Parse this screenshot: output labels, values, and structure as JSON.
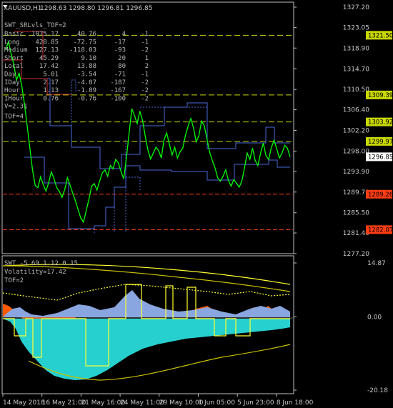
{
  "header": {
    "symbol": "XAUUSD,H1",
    "ohlc": "1298.63 1298.80 1296.81 1296.85"
  },
  "info_panel": {
    "title": "SWT_SRLvls_TOF=2",
    "rows": [
      {
        "label": "Basic",
        "a": "1075.17",
        "b": "40.76",
        "c": "4",
        "d": "-1"
      },
      {
        "label": "Long",
        "a": "428.85",
        "b": "-72.75",
        "c": "-17",
        "d": "-1"
      },
      {
        "label": "Medium",
        "a": "127.13",
        "b": "-118.03",
        "c": "-93",
        "d": "-2"
      },
      {
        "label": "Short",
        "a": "45.29",
        "b": "9.10",
        "c": "20",
        "d": "1"
      },
      {
        "label": "Local",
        "a": "17.42",
        "b": "13.88",
        "c": "80",
        "d": "2"
      },
      {
        "label": "Day",
        "a": "5.01",
        "b": "-3.54",
        "c": "-71",
        "d": "-1"
      },
      {
        "label": "IDay",
        "a": "2.17",
        "b": "-4.07",
        "c": "-187",
        "d": "-2"
      },
      {
        "label": "Hour",
        "a": "1.13",
        "b": "-1.89",
        "c": "-167",
        "d": "-2"
      },
      {
        "label": "IHour",
        "a": "0.76",
        "b": "-0.76",
        "c": "-100",
        "d": "-2"
      }
    ],
    "v_line": "V=2.31",
    "tof_line": "TOF=4"
  },
  "indicator": {
    "line1": "SWT -5.69 1.12 0.15",
    "line2": "Volatility=17.42",
    "line3": "TOF=2"
  },
  "colors": {
    "price": "#00ff00",
    "channel": "#4a6ad8",
    "level_green": "#c8d800",
    "level_red": "#ff3c14",
    "cyan": "#26d0ce",
    "orange": "#ff5a00",
    "yellow": "#ffff30",
    "blue_fill": "#8aa6e0",
    "gold": "#c8c000"
  },
  "chart_data": [
    {
      "type": "line",
      "title": "XAUUSD,H1",
      "y_ticks": [
        "1327.20",
        "1323.05",
        "1318.90",
        "1314.70",
        "1310.50",
        "1306.40",
        "1302.20",
        "1298.00",
        "1293.90",
        "1289.70",
        "1285.50",
        "1281.40",
        "1277.20"
      ],
      "x_ticks": [
        "14 May 2018",
        "16 May 21:00",
        "21 May 16:00",
        "24 May 11:00",
        "29 May 10:00",
        "1 Jun 05:00",
        "5 Jun 23:00",
        "8 Jun 18:00"
      ],
      "ylim": [
        1277.2,
        1327.2
      ],
      "last_price": "1296.85",
      "price_levels": [
        {
          "value": 1321.5,
          "label": "1321.50",
          "color": "green"
        },
        {
          "value": 1309.39,
          "label": "1309.39",
          "color": "green"
        },
        {
          "value": 1303.92,
          "label": "1303.92",
          "color": "green"
        },
        {
          "value": 1299.97,
          "label": "1299.97",
          "color": "green"
        },
        {
          "value": 1289.26,
          "label": "1289.26",
          "color": "red"
        },
        {
          "value": 1282.07,
          "label": "1282.07",
          "color": "red"
        }
      ],
      "series": [
        {
          "values": [
            1318.5,
            1320.2,
            1317.8,
            1315.6,
            1312.4,
            1313.8,
            1311.2,
            1307.5,
            1303.1,
            1298.6,
            1294.2,
            1291.0,
            1290.6,
            1292.8,
            1291.2,
            1289.9,
            1291.6,
            1293.8,
            1292.4,
            1290.6,
            1289.8,
            1288.6,
            1290.2,
            1292.6,
            1291.1,
            1289.4,
            1287.9,
            1286.1,
            1284.4,
            1283.6,
            1285.9,
            1288.2,
            1290.9,
            1291.4,
            1290.1,
            1291.9,
            1293.6,
            1294.2,
            1292.9,
            1295.1,
            1294.4,
            1296.3,
            1295.6,
            1293.8,
            1292.4,
            1296.8,
            1301.6,
            1306.6,
            1305.2,
            1303.6,
            1306.1,
            1304.2,
            1301.1,
            1298.2,
            1296.4,
            1297.6,
            1298.8,
            1298.1,
            1296.6,
            1300.3,
            1301.7,
            1299.4,
            1297.2,
            1298.8,
            1296.6,
            1297.9,
            1298.6,
            1301.2,
            1303.1,
            1304.6,
            1302.7,
            1299.9,
            1301.1,
            1304.1,
            1303.2,
            1300.5,
            1297.8,
            1296.1,
            1294.6,
            1292.6,
            1291.9,
            1292.9,
            1294.2,
            1292.1,
            1290.9,
            1292.2,
            1291.5,
            1290.7,
            1291.9,
            1294.6,
            1297.6,
            1296.3,
            1298.6,
            1296.1,
            1295.1,
            1297.6,
            1299.6,
            1297.1,
            1296.3,
            1298.7,
            1300.2,
            1298.5,
            1296.6,
            1297.6,
            1299.2,
            1298.6,
            1296.85
          ]
        }
      ]
    },
    {
      "type": "area",
      "title": "SWT -5.69 1.12 0.15",
      "y_ticks": [
        "14.87",
        "0.00",
        "-20.18"
      ],
      "ylim": [
        -20.18,
        14.87
      ]
    }
  ]
}
